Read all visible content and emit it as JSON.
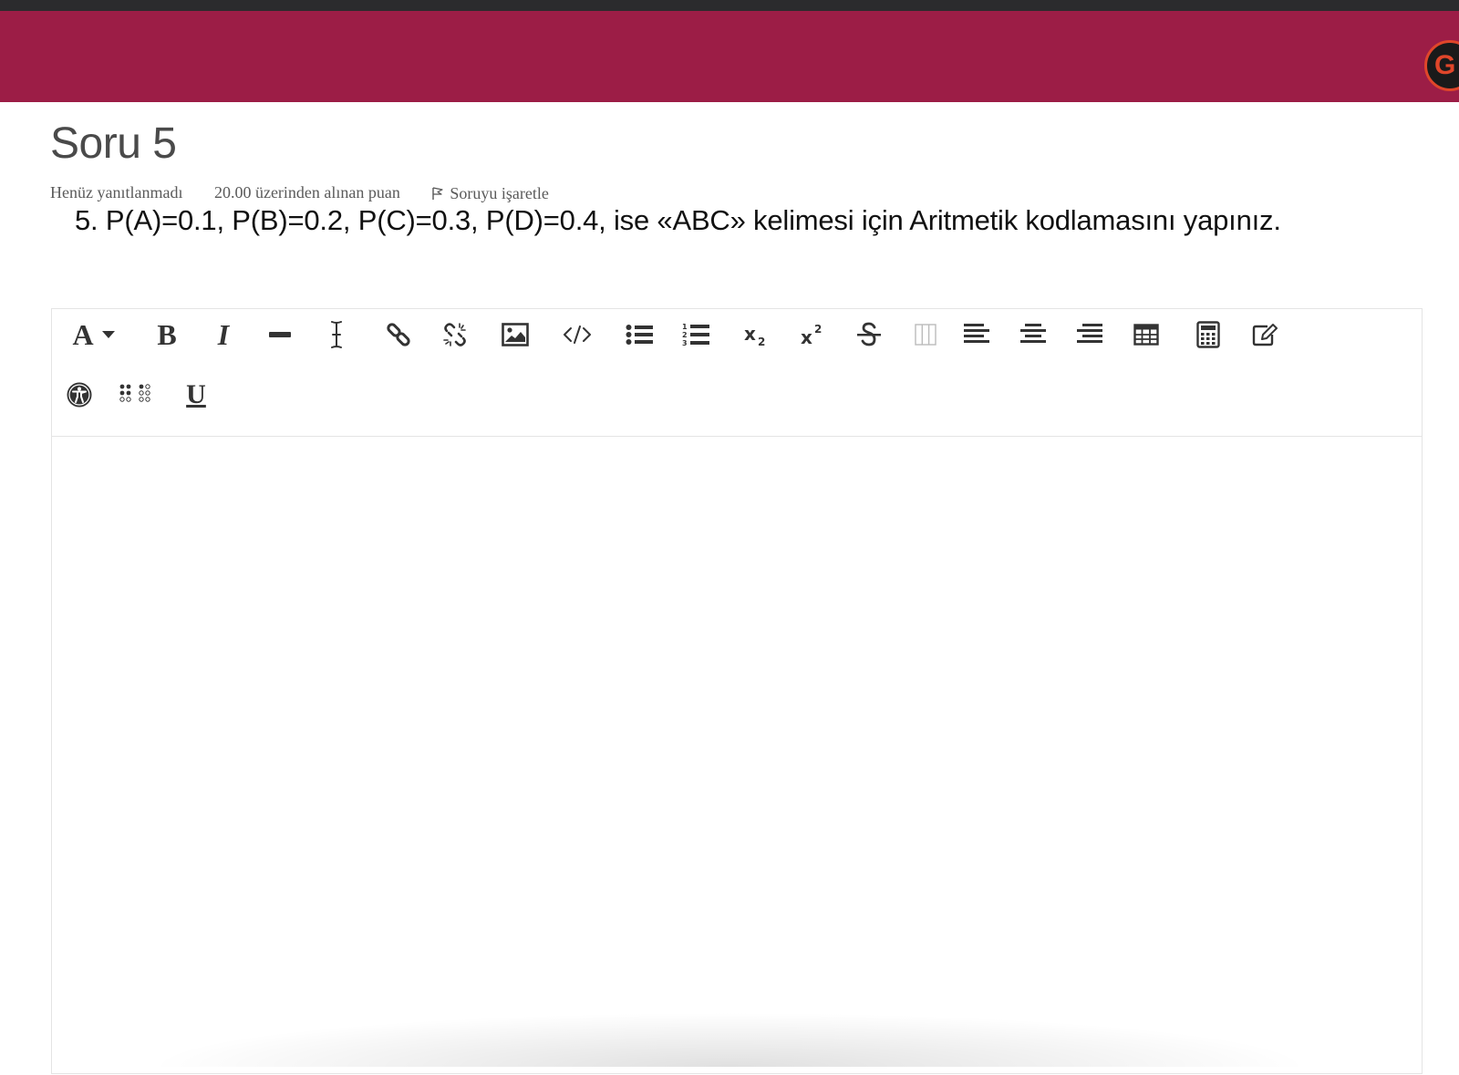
{
  "header": {
    "avatar_letter": "G",
    "brand_color": "#9c1d46"
  },
  "question": {
    "title": "Soru 5",
    "status": "Henüz yanıtlanmadı",
    "score_text": "20.00 üzerinden alınan puan",
    "flag_label": "Soruyu işaretle",
    "text": "5. P(A)=0.1, P(B)=0.2, P(C)=0.3, P(D)=0.4, ise «ABC» kelimesi için Aritmetik kodlamasını yapınız."
  },
  "editor": {
    "toolbar_row1": [
      "font-style-dropdown-icon",
      "bold-icon",
      "italic-icon",
      "horizontal-rule-icon",
      "clear-formatting-icon",
      "link-icon",
      "unlink-icon",
      "image-icon",
      "code-icon",
      "bullet-list-icon",
      "numbered-list-icon",
      "subscript-icon",
      "superscript-icon",
      "strikethrough-icon",
      "columns-icon",
      "align-left-icon",
      "align-center-icon",
      "align-right-icon",
      "table-icon",
      "calculator-icon",
      "edit-icon"
    ],
    "toolbar_row2": [
      "accessibility-icon",
      "braille-icon",
      "underline-icon"
    ],
    "bold_glyph": "B",
    "italic_glyph": "I",
    "underline_glyph": "U",
    "font_glyph": "A",
    "content": ""
  }
}
